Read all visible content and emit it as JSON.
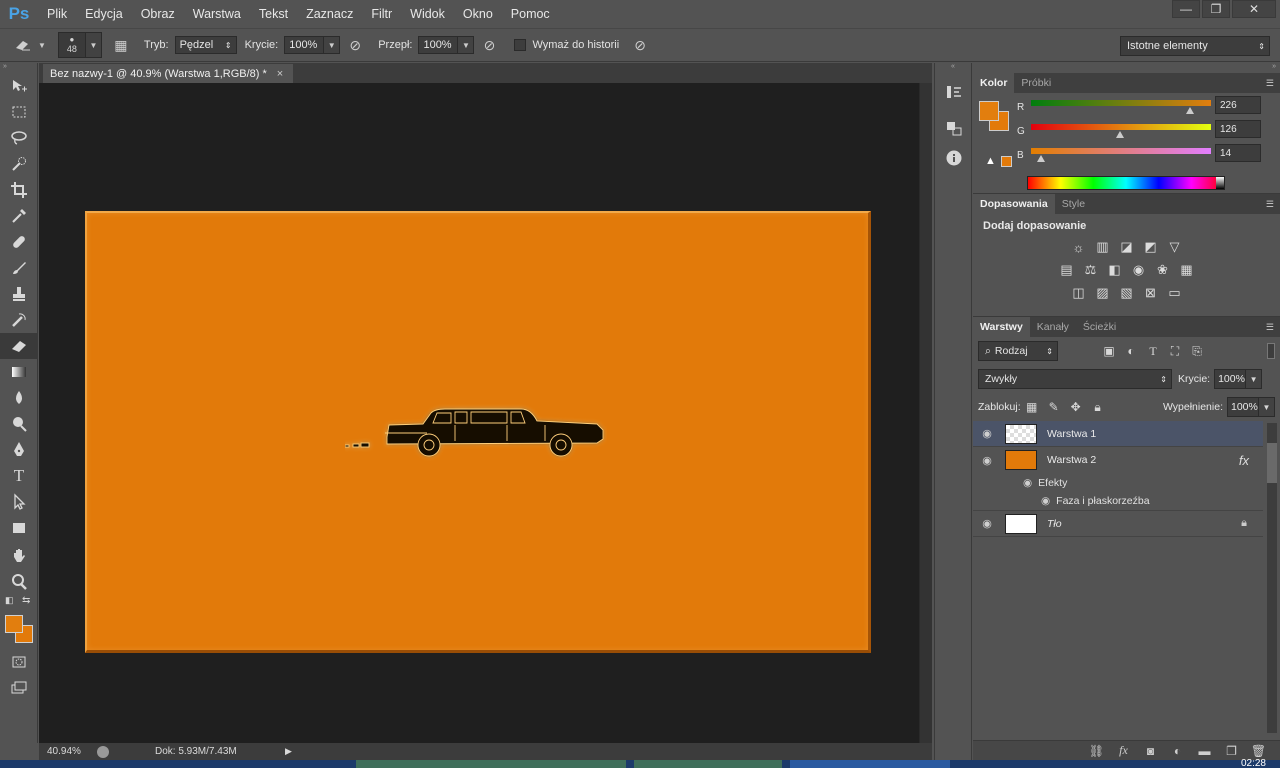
{
  "app": {
    "logo": "Ps"
  },
  "menu": [
    "Plik",
    "Edycja",
    "Obraz",
    "Warstwa",
    "Tekst",
    "Zaznacz",
    "Filtr",
    "Widok",
    "Okno",
    "Pomoc"
  ],
  "window_controls": {
    "minimize": "—",
    "restore": "❐",
    "close": "✕"
  },
  "options": {
    "brush_size": "48",
    "mode_label": "Tryb:",
    "mode_value": "Pędzel",
    "opacity_label": "Krycie:",
    "opacity_value": "100%",
    "flow_label": "Przepł:",
    "flow_value": "100%",
    "erase_history_label": "Wymaż do historii",
    "workspace": "Istotne elementy"
  },
  "document": {
    "tab_title": "Bez nazwy-1 @ 40.9% (Warstwa 1,RGB/8) *",
    "tab_close": "×",
    "canvas_color": "#e27a0a"
  },
  "status": {
    "zoom": "40.94%",
    "doc_info": "Dok: 5.93M/7.43M",
    "arrow": "▶"
  },
  "colors": {
    "foreground": "#e27e0e",
    "background": "#e27a0a",
    "accent_blue": "#4aa3e6"
  },
  "color_panel": {
    "tabs": [
      "Kolor",
      "Próbki"
    ],
    "r_label": "R",
    "g_label": "G",
    "b_label": "B",
    "r": "226",
    "g": "126",
    "b": "14",
    "r_fraction": 0.886,
    "g_fraction": 0.494,
    "b_fraction": 0.055
  },
  "adjustments": {
    "tabs": [
      "Dopasowania",
      "Style"
    ],
    "title": "Dodaj dopasowanie",
    "row1": [
      "brightness-icon",
      "levels-icon",
      "curves-icon",
      "exposure-icon",
      "vibrance-icon"
    ],
    "row2": [
      "hue-sat-icon",
      "color-balance-icon",
      "bw-icon",
      "photo-filter-icon",
      "channel-mixer-icon",
      "color-lookup-icon"
    ],
    "row3": [
      "invert-icon",
      "posterize-icon",
      "threshold-icon",
      "selective-color-icon",
      "gradient-map-icon"
    ]
  },
  "layers": {
    "tabs": [
      "Warstwy",
      "Kanały",
      "Ścieżki"
    ],
    "filter_kind": "Rodzaj",
    "blend_mode": "Zwykły",
    "opacity_label": "Krycie:",
    "opacity_value": "100%",
    "lock_label": "Zablokuj:",
    "fill_label": "Wypełnienie:",
    "fill_value": "100%",
    "items": [
      {
        "name": "Warstwa 1",
        "selected": true
      },
      {
        "name": "Warstwa 2",
        "fx": "fx",
        "effects_label": "Efekty",
        "effect": "Faza i płaskorzeźba"
      },
      {
        "name": "Tło"
      }
    ]
  },
  "taskbar": {
    "clock": "02:28"
  }
}
